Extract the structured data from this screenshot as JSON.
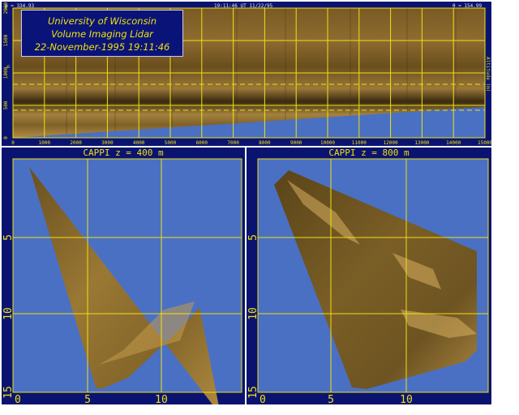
{
  "rhi": {
    "azimuth_readout": "φ = 334.93",
    "timestamp": "19:11:46 UT 11/22/95",
    "elevation_readout": "θ = 154.99",
    "side_label": "Altitude (m)",
    "y_unit": "m",
    "title_lines": [
      "University of Wisconsin",
      "Volume Imaging Lidar",
      "22-November-1995 19:11:46"
    ],
    "x_ticks": [
      "0",
      "1000",
      "2000",
      "3000",
      "4000",
      "5000",
      "6000",
      "7000",
      "8000",
      "9000",
      "10000",
      "11000",
      "12000",
      "13000",
      "14000",
      "15000"
    ],
    "y_ticks": [
      "0",
      "500",
      "1000",
      "1500",
      "2000"
    ]
  },
  "cappi_left": {
    "title": "CAPPI  z = 400 m",
    "x_ticks": [
      "0",
      "5",
      "10"
    ],
    "y_ticks": [
      "5",
      "10",
      "15"
    ]
  },
  "cappi_right": {
    "title": "CAPPI  z = 800 m",
    "x_ticks": [
      "0",
      "5",
      "10"
    ],
    "y_ticks": [
      "5",
      "10",
      "15"
    ]
  },
  "colors": {
    "frame": "#0a1470",
    "sky": "#4a70c4",
    "grid": "#f0e010",
    "scan": "#8a6a2c",
    "title_box": "#0a1478"
  }
}
